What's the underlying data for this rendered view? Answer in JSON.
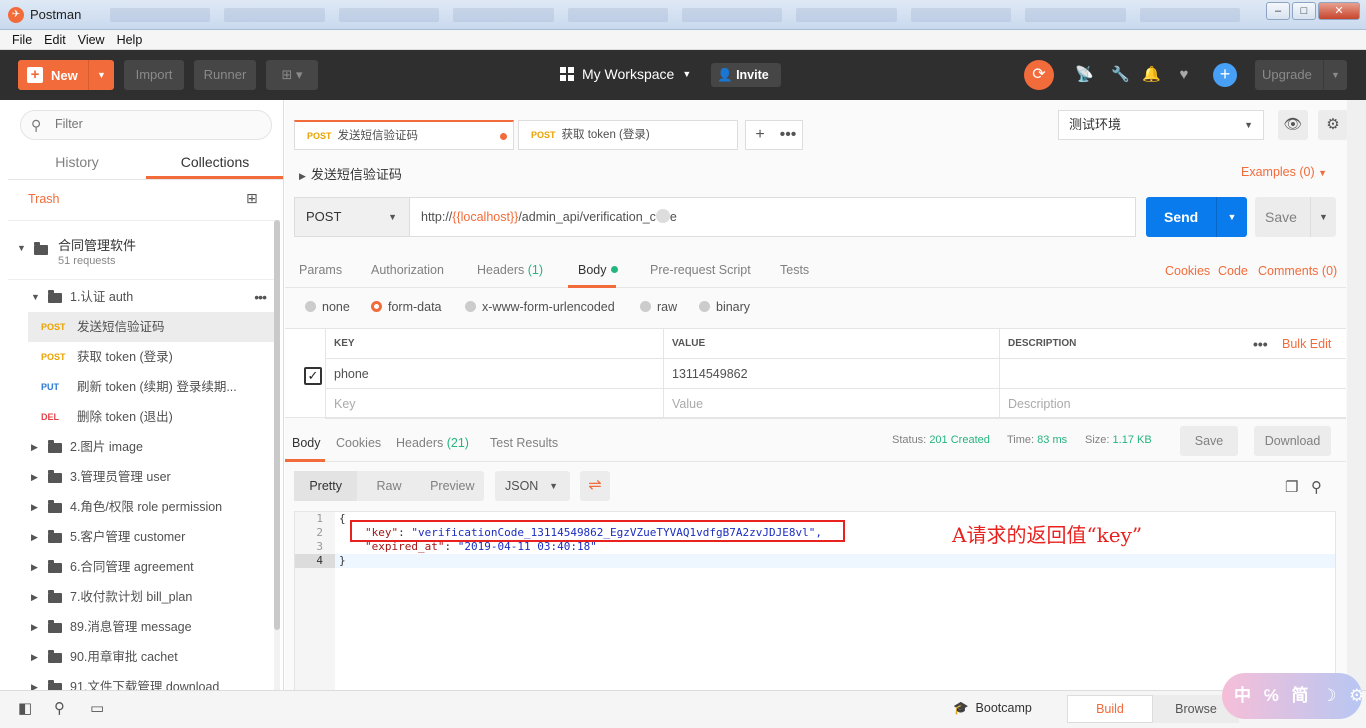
{
  "window": {
    "title": "Postman",
    "btn_min": "–",
    "btn_max": "□",
    "btn_close": "✕"
  },
  "menu": [
    "File",
    "Edit",
    "View",
    "Help"
  ],
  "header": {
    "new_label": "New",
    "import_label": "Import",
    "runner_label": "Runner",
    "workspace": "My Workspace",
    "invite": "Invite",
    "upgrade": "Upgrade"
  },
  "sidebar": {
    "filter_placeholder": "Filter",
    "tabs": [
      "History",
      "Collections"
    ],
    "trash": "Trash",
    "collection": {
      "name": "合同管理软件",
      "count": "51 requests"
    },
    "folder_open": "1.认证 auth",
    "requests": [
      {
        "method": "POST",
        "name": "发送短信验证码"
      },
      {
        "method": "POST",
        "name": "获取 token (登录)"
      },
      {
        "method": "PUT",
        "name": "刷新 token (续期) 登录续期..."
      },
      {
        "method": "DEL",
        "name": "删除 token (退出)"
      }
    ],
    "folders": [
      "2.图片 image",
      "3.管理员管理 user",
      "4.角色/权限 role permission",
      "5.客户管理 customer",
      "6.合同管理 agreement",
      "7.收付款计划 bill_plan",
      "89.消息管理 message",
      "90.用章审批 cachet",
      "91.文件下载管理 download"
    ]
  },
  "tabs": [
    {
      "method": "POST",
      "name": "发送短信验证码"
    },
    {
      "method": "POST",
      "name": "获取 token (登录)"
    }
  ],
  "environment": "测试环境",
  "request": {
    "name": "发送短信验证码",
    "examples": "Examples (0)",
    "method": "POST",
    "url_prefix": "http://",
    "url_var": "{{localhost}}",
    "url_suffix": "/admin_api/verification_c",
    "url_end": "e",
    "send": "Send",
    "save": "Save",
    "nav": {
      "params": "Params",
      "authorization": "Authorization",
      "headers": "Headers",
      "headers_count": "(1)",
      "body": "Body",
      "prerequest": "Pre-request Script",
      "tests": "Tests"
    },
    "links": {
      "cookies": "Cookies",
      "code": "Code",
      "comments": "Comments (0)"
    },
    "body_types": [
      "none",
      "form-data",
      "x-www-form-urlencoded",
      "raw",
      "binary"
    ],
    "kv": {
      "headers": [
        "KEY",
        "VALUE",
        "DESCRIPTION"
      ],
      "bulk_edit": "Bulk Edit",
      "row": {
        "key": "phone",
        "value": "13114549862",
        "description": ""
      },
      "placeholders": {
        "key": "Key",
        "value": "Value",
        "description": "Description"
      }
    }
  },
  "response": {
    "tabs": {
      "body": "Body",
      "cookies": "Cookies",
      "headers": "Headers",
      "headers_count": "(21)",
      "tests": "Test Results"
    },
    "status_label": "Status:",
    "status": "201 Created",
    "time_label": "Time:",
    "time": "83 ms",
    "size_label": "Size:",
    "size": "1.17 KB",
    "save": "Save",
    "download": "Download",
    "formats": [
      "Pretty",
      "Raw",
      "Preview"
    ],
    "lang": "JSON",
    "lines": [
      "1",
      "2",
      "3",
      "4"
    ],
    "code": {
      "open": "{",
      "key_name": "\"key\"",
      "key_value": "\"verificationCode_13114549862_EgzVZueTYVAQ1vdfgB7A2zvJDJE8vl\",",
      "exp_name": "\"expired_at\"",
      "exp_value": "\"2019-04-11 03:40:18\"",
      "close": "}"
    },
    "annotation": "A请求的返回值“key”"
  },
  "footer": {
    "bootcamp": "Bootcamp",
    "build": "Build",
    "browse": "Browse"
  },
  "ime": "中 ℅ 简 ☽ ⚙ 👕",
  "colors": {
    "accent": "#f26b3a",
    "send_blue": "#097bed",
    "success": "#26b47f",
    "annotation_red": "#e8221e"
  }
}
